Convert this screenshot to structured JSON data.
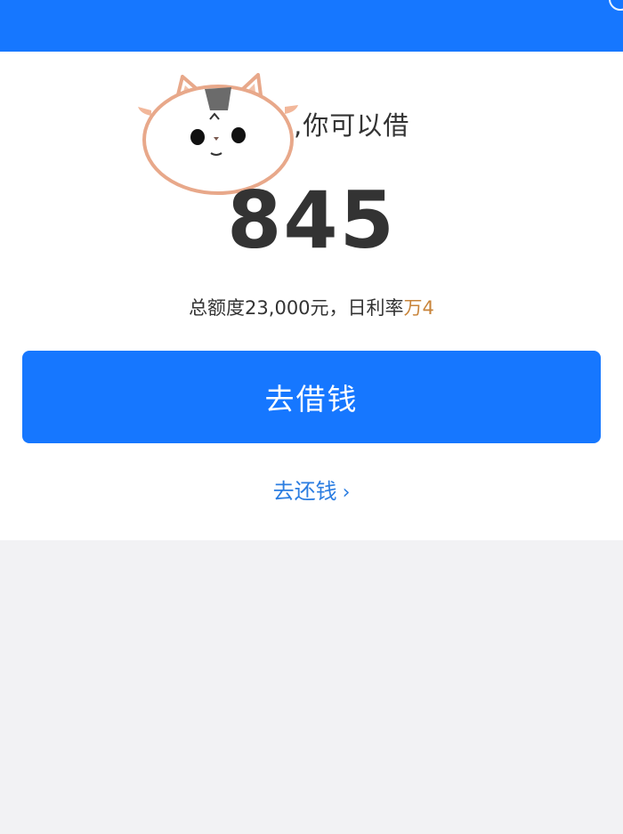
{
  "top_bar": {
    "color": "#1677ff"
  },
  "header": {
    "greeting_suffix": ",你可以借"
  },
  "avatar": {
    "icon": "cat-face-icon"
  },
  "amount": {
    "value": "845"
  },
  "credit": {
    "text": "总额度23,000元，日利率",
    "rate": "万4",
    "rate_color": "#c8843a"
  },
  "actions": {
    "borrow_label": "去借钱",
    "repay_label": "去还钱",
    "repay_chevron": "›"
  },
  "colors": {
    "primary": "#1677ff",
    "link": "#2b7de1",
    "background": "#f2f2f4"
  }
}
